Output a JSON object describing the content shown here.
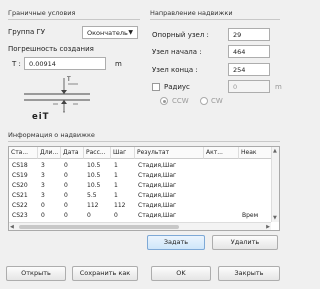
{
  "boundary": {
    "title": "Граничные условия",
    "group_label": "Группа ГУ",
    "group_value": "Окончатель",
    "accuracy_label": "Погрешность создания",
    "t_label": "T :",
    "t_value": "0.00914",
    "t_unit": "m",
    "diagram_label": "eiT",
    "diagram_t": "T"
  },
  "direction": {
    "title": "Направление надвижки",
    "ref_node_label": "Опорный узел :",
    "ref_node_value": "29",
    "start_node_label": "Узел начала :",
    "start_node_value": "464",
    "end_node_label": "Узел конца :",
    "end_node_value": "254",
    "radius_label": "Радиус",
    "radius_value": "0",
    "radius_unit": "m",
    "ccw_label": "CCW",
    "cw_label": "CW"
  },
  "info": {
    "title": "Информация о надвижке",
    "columns": [
      "Ста...",
      "Дли...",
      "Дата",
      "Расс...",
      "Шаг",
      "Результат",
      "Акт...",
      "Неак"
    ],
    "rows": [
      [
        "CS18",
        "3",
        "0",
        "10.5",
        "1",
        "Стадия,Шаг",
        "",
        ""
      ],
      [
        "CS19",
        "3",
        "0",
        "10.5",
        "1",
        "Стадия,Шаг",
        "",
        ""
      ],
      [
        "CS20",
        "3",
        "0",
        "10.5",
        "1",
        "Стадия,Шаг",
        "",
        ""
      ],
      [
        "CS21",
        "3",
        "0",
        "5.5",
        "1",
        "Стадия,Шаг",
        "",
        ""
      ],
      [
        "CS22",
        "0",
        "0",
        "112",
        "112",
        "Стадия,Шаг",
        "",
        ""
      ],
      [
        "CS23",
        "0",
        "0",
        "0",
        "0",
        "Стадия,Шаг",
        "",
        "Врем"
      ]
    ]
  },
  "actions": {
    "set_label": "Задать",
    "delete_label": "Удалить"
  },
  "footer": {
    "open_label": "Открыть",
    "save_as_label": "Сохранить как",
    "ok_label": "OK",
    "close_label": "Закрыть"
  }
}
